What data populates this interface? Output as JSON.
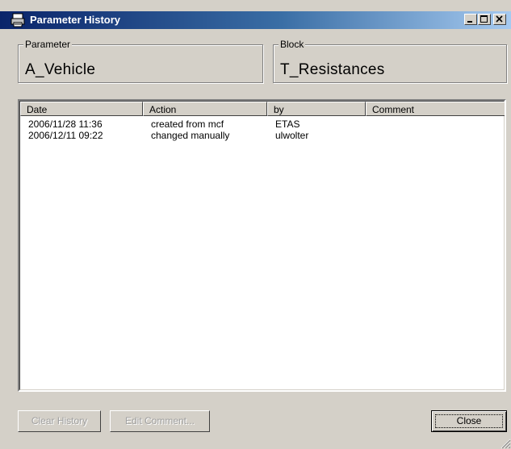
{
  "window": {
    "title": "Parameter History",
    "icon": "printer-icon"
  },
  "parameter": {
    "legend": "Parameter",
    "value": "A_Vehicle"
  },
  "block": {
    "legend": "Block",
    "value": "T_Resistances"
  },
  "table": {
    "columns": [
      "Date",
      "Action",
      "by",
      "Comment"
    ],
    "rows": [
      [
        "2006/11/28  11:36",
        "created from mcf",
        "ETAS",
        ""
      ],
      [
        "2006/12/11  09:22",
        "changed manually",
        "ulwolter",
        ""
      ]
    ]
  },
  "buttons": {
    "clear_history": "Clear History",
    "edit_comment": "Edit Comment...",
    "close": "Close"
  }
}
